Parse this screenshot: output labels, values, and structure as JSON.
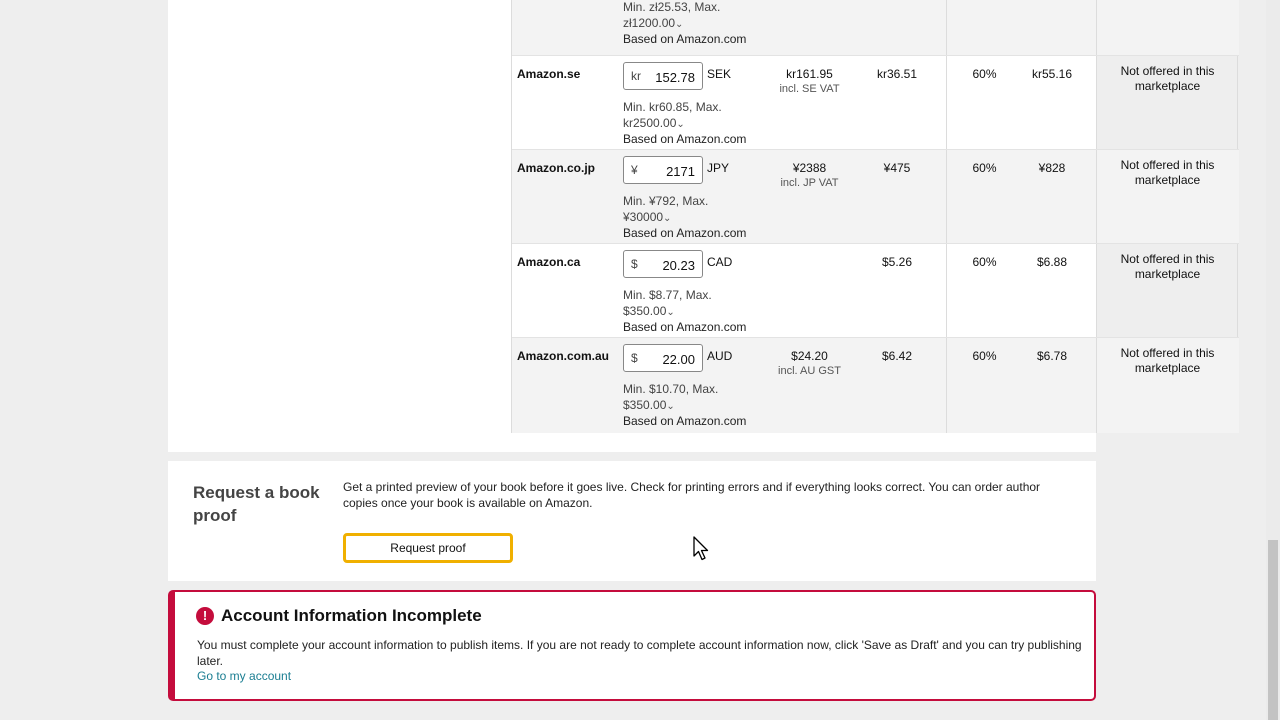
{
  "top_fragment": {
    "minmax_line1": "Min. zł25.53, Max.",
    "minmax_line2": "zł1200.00",
    "based_on": "Based on Amazon.com"
  },
  "rows": [
    {
      "marketplace": "Amazon.se",
      "currency_symbol": "kr",
      "price": "152.78",
      "currency": "SEK",
      "minmax_line1": "Min. kr60.85, Max.",
      "minmax_line2": "kr2500.00",
      "based_on": "Based on Amazon.com",
      "list_price": "kr161.95",
      "vat_note": "incl. SE VAT",
      "delivery": "kr36.51",
      "rate": "60%",
      "royalty": "kr55.16",
      "expanded": "Not offered in this marketplace"
    },
    {
      "marketplace": "Amazon.co.jp",
      "currency_symbol": "¥",
      "price": "2171",
      "currency": "JPY",
      "minmax_line1": "Min. ¥792, Max.",
      "minmax_line2": "¥30000",
      "based_on": "Based on Amazon.com",
      "list_price": "¥2388",
      "vat_note": "incl. JP VAT",
      "delivery": "¥475",
      "rate": "60%",
      "royalty": "¥828",
      "expanded": "Not offered in this marketplace"
    },
    {
      "marketplace": "Amazon.ca",
      "currency_symbol": "$",
      "price": "20.23",
      "currency": "CAD",
      "minmax_line1": "Min. $8.77, Max.",
      "minmax_line2": "$350.00",
      "based_on": "Based on Amazon.com",
      "list_price": "",
      "vat_note": "",
      "delivery": "$5.26",
      "rate": "60%",
      "royalty": "$6.88",
      "expanded": "Not offered in this marketplace"
    },
    {
      "marketplace": "Amazon.com.au",
      "currency_symbol": "$",
      "price": "22.00",
      "currency": "AUD",
      "minmax_line1": "Min. $10.70, Max.",
      "minmax_line2": "$350.00",
      "based_on": "Based on Amazon.com",
      "list_price": "$24.20",
      "vat_note": "incl. AU GST",
      "delivery": "$6.42",
      "rate": "60%",
      "royalty": "$6.78",
      "expanded": "Not offered in this marketplace"
    }
  ],
  "proof": {
    "heading": "Request a book proof",
    "description": "Get a printed preview of your book before it goes live. Check for printing errors and if everything looks correct. You can order author copies once your book is available on Amazon.",
    "button_label": "Request proof"
  },
  "alert": {
    "icon": "!",
    "title": "Account Information Incomplete",
    "body": "You must complete your account information to publish items. If you are not ready to complete account information now, click 'Save as Draft' and you can try publishing later.",
    "link": "Go to my account"
  },
  "colors": {
    "alert_red": "#c40c3c",
    "button_outline": "#f0b000",
    "link": "#1b7e92"
  }
}
